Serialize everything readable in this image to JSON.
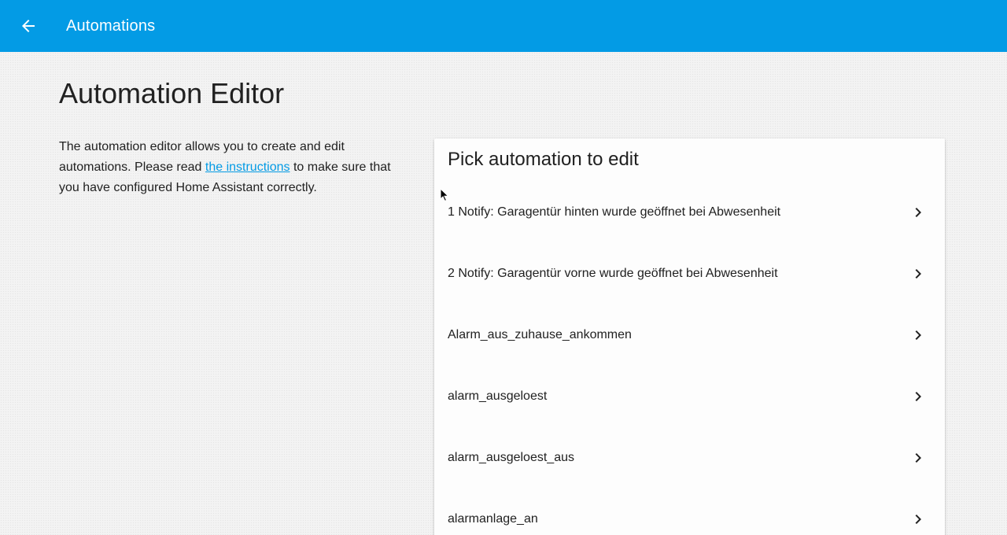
{
  "toolbar": {
    "title": "Automations",
    "back_icon": "arrow-left-icon",
    "color": "#039be5"
  },
  "page": {
    "title": "Automation Editor",
    "intro_before": "The automation editor allows you to create and edit automations. Please read ",
    "intro_link": "the instructions",
    "intro_after": " to make sure that you have configured Home Assistant correctly."
  },
  "card": {
    "header": "Pick automation to edit",
    "items": [
      {
        "label": "1 Notify: Garagentür hinten wurde geöffnet bei Abwesenheit"
      },
      {
        "label": "2 Notify: Garagentür vorne wurde geöffnet bei Abwesenheit"
      },
      {
        "label": "Alarm_aus_zuhause_ankommen"
      },
      {
        "label": "alarm_ausgeloest"
      },
      {
        "label": "alarm_ausgeloest_aus"
      },
      {
        "label": "alarmanlage_an"
      }
    ],
    "chevron_icon": "chevron-right-icon"
  }
}
